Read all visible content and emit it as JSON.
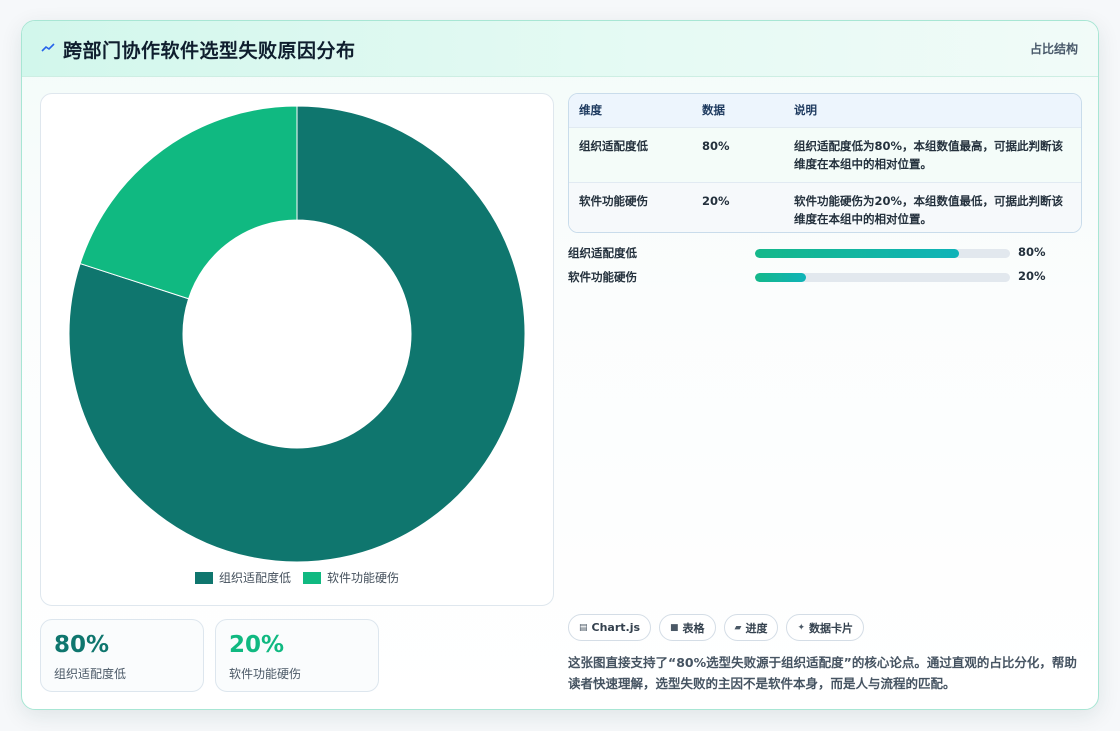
{
  "header": {
    "title": "跨部门协作软件选型失败原因分布",
    "tag": "占比结构"
  },
  "colors": {
    "primary": "#0f766e",
    "secondary": "#10b981",
    "accent": "#14b8a6"
  },
  "chart_data": {
    "type": "pie",
    "variant": "doughnut",
    "categories": [
      "组织适配度低",
      "软件功能硬伤"
    ],
    "values": [
      80,
      20
    ],
    "colors": [
      "#0f766e",
      "#10b981"
    ],
    "legend": "bottom"
  },
  "stats": [
    {
      "value": "80%",
      "label": "组织适配度低"
    },
    {
      "value": "20%",
      "label": "软件功能硬伤"
    }
  ],
  "table": {
    "headers": [
      "维度",
      "数据",
      "说明"
    ],
    "rows": [
      {
        "dim": "组织适配度低",
        "val": "80%",
        "desc": "组织适配度低为80%，本组数值最高，可据此判断该维度在本组中的相对位置。"
      },
      {
        "dim": "软件功能硬伤",
        "val": "20%",
        "desc": "软件功能硬伤为20%，本组数值最低，可据此判断该维度在本组中的相对位置。"
      }
    ]
  },
  "progress": [
    {
      "label": "组织适配度低",
      "value": 80,
      "display": "80%"
    },
    {
      "label": "软件功能硬伤",
      "value": 20,
      "display": "20%"
    }
  ],
  "chips": [
    {
      "icon": "chart-icon",
      "label": "Chart.js"
    },
    {
      "icon": "table-icon",
      "label": "表格"
    },
    {
      "icon": "progress-icon",
      "label": "进度"
    },
    {
      "icon": "sparkle-icon",
      "label": "数据卡片"
    }
  ],
  "summary": "这张图直接支持了“80%选型失败源于组织适配度”的核心论点。通过直观的占比分化，帮助读者快速理解，选型失败的主因不是软件本身，而是人与流程的匹配。"
}
